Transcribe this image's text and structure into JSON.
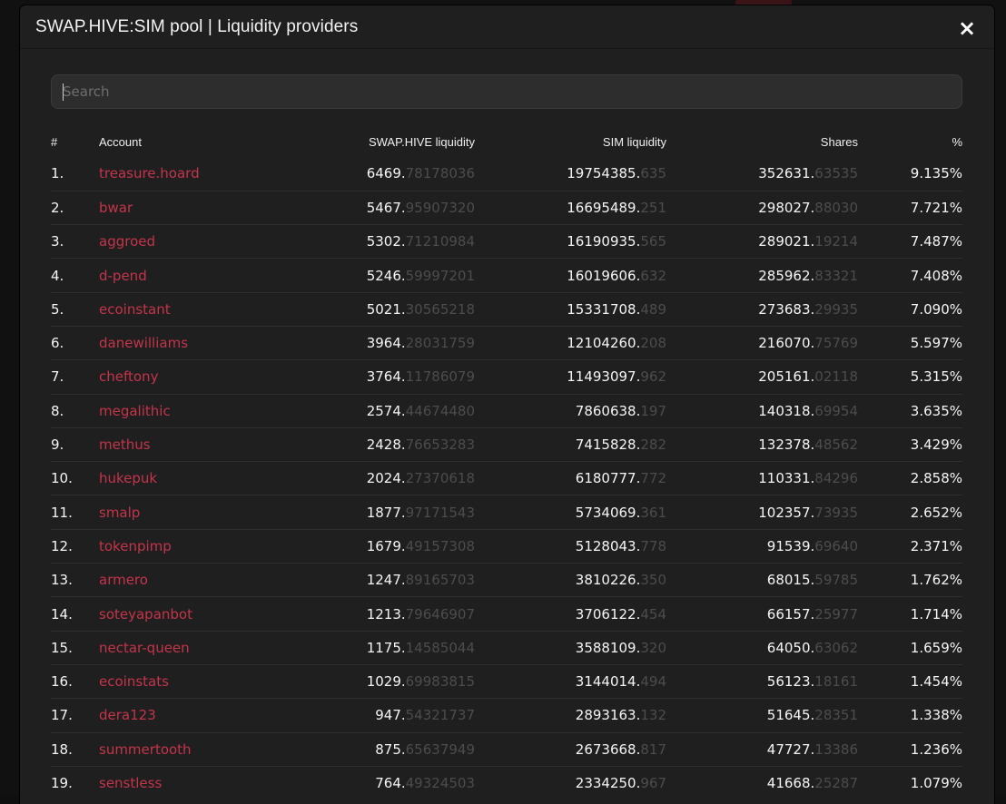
{
  "modal": {
    "title": "SWAP.HIVE:SIM pool | Liquidity providers",
    "close_label": "×"
  },
  "search": {
    "placeholder": "Search",
    "value": ""
  },
  "table": {
    "columns": [
      "#",
      "Account",
      "SWAP.HIVE liquidity",
      "SIM liquidity",
      "Shares",
      "%"
    ],
    "rows": [
      {
        "rank": "1.",
        "account": "treasure.hoard",
        "hive_int": "6469.",
        "hive_dec": "78178036",
        "sim_int": "19754385.",
        "sim_dec": "635",
        "shares_int": "352631.",
        "shares_dec": "63535",
        "pct": "9.135%"
      },
      {
        "rank": "2.",
        "account": "bwar",
        "hive_int": "5467.",
        "hive_dec": "95907320",
        "sim_int": "16695489.",
        "sim_dec": "251",
        "shares_int": "298027.",
        "shares_dec": "88030",
        "pct": "7.721%"
      },
      {
        "rank": "3.",
        "account": "aggroed",
        "hive_int": "5302.",
        "hive_dec": "71210984",
        "sim_int": "16190935.",
        "sim_dec": "565",
        "shares_int": "289021.",
        "shares_dec": "19214",
        "pct": "7.487%"
      },
      {
        "rank": "4.",
        "account": "d-pend",
        "hive_int": "5246.",
        "hive_dec": "59997201",
        "sim_int": "16019606.",
        "sim_dec": "632",
        "shares_int": "285962.",
        "shares_dec": "83321",
        "pct": "7.408%"
      },
      {
        "rank": "5.",
        "account": "ecoinstant",
        "hive_int": "5021.",
        "hive_dec": "30565218",
        "sim_int": "15331708.",
        "sim_dec": "489",
        "shares_int": "273683.",
        "shares_dec": "29935",
        "pct": "7.090%"
      },
      {
        "rank": "6.",
        "account": "danewilliams",
        "hive_int": "3964.",
        "hive_dec": "28031759",
        "sim_int": "12104260.",
        "sim_dec": "208",
        "shares_int": "216070.",
        "shares_dec": "75769",
        "pct": "5.597%"
      },
      {
        "rank": "7.",
        "account": "cheftony",
        "hive_int": "3764.",
        "hive_dec": "11786079",
        "sim_int": "11493097.",
        "sim_dec": "962",
        "shares_int": "205161.",
        "shares_dec": "02118",
        "pct": "5.315%"
      },
      {
        "rank": "8.",
        "account": "megalithic",
        "hive_int": "2574.",
        "hive_dec": "44674480",
        "sim_int": "7860638.",
        "sim_dec": "197",
        "shares_int": "140318.",
        "shares_dec": "69954",
        "pct": "3.635%"
      },
      {
        "rank": "9.",
        "account": "methus",
        "hive_int": "2428.",
        "hive_dec": "76653283",
        "sim_int": "7415828.",
        "sim_dec": "282",
        "shares_int": "132378.",
        "shares_dec": "48562",
        "pct": "3.429%"
      },
      {
        "rank": "10.",
        "account": "hukepuk",
        "hive_int": "2024.",
        "hive_dec": "27370618",
        "sim_int": "6180777.",
        "sim_dec": "772",
        "shares_int": "110331.",
        "shares_dec": "84296",
        "pct": "2.858%"
      },
      {
        "rank": "11.",
        "account": "smalp",
        "hive_int": "1877.",
        "hive_dec": "97171543",
        "sim_int": "5734069.",
        "sim_dec": "361",
        "shares_int": "102357.",
        "shares_dec": "73935",
        "pct": "2.652%"
      },
      {
        "rank": "12.",
        "account": "tokenpimp",
        "hive_int": "1679.",
        "hive_dec": "49157308",
        "sim_int": "5128043.",
        "sim_dec": "778",
        "shares_int": "91539.",
        "shares_dec": "69640",
        "pct": "2.371%"
      },
      {
        "rank": "13.",
        "account": "armero",
        "hive_int": "1247.",
        "hive_dec": "89165703",
        "sim_int": "3810226.",
        "sim_dec": "350",
        "shares_int": "68015.",
        "shares_dec": "59785",
        "pct": "1.762%"
      },
      {
        "rank": "14.",
        "account": "soteyapanbot",
        "hive_int": "1213.",
        "hive_dec": "79646907",
        "sim_int": "3706122.",
        "sim_dec": "454",
        "shares_int": "66157.",
        "shares_dec": "25977",
        "pct": "1.714%"
      },
      {
        "rank": "15.",
        "account": "nectar-queen",
        "hive_int": "1175.",
        "hive_dec": "14585044",
        "sim_int": "3588109.",
        "sim_dec": "320",
        "shares_int": "64050.",
        "shares_dec": "63062",
        "pct": "1.659%"
      },
      {
        "rank": "16.",
        "account": "ecoinstats",
        "hive_int": "1029.",
        "hive_dec": "69983815",
        "sim_int": "3144014.",
        "sim_dec": "494",
        "shares_int": "56123.",
        "shares_dec": "18161",
        "pct": "1.454%"
      },
      {
        "rank": "17.",
        "account": "dera123",
        "hive_int": "947.",
        "hive_dec": "54321737",
        "sim_int": "2893163.",
        "sim_dec": "132",
        "shares_int": "51645.",
        "shares_dec": "28351",
        "pct": "1.338%"
      },
      {
        "rank": "18.",
        "account": "summertooth",
        "hive_int": "875.",
        "hive_dec": "65637949",
        "sim_int": "2673668.",
        "sim_dec": "817",
        "shares_int": "47727.",
        "shares_dec": "13386",
        "pct": "1.236%"
      },
      {
        "rank": "19.",
        "account": "senstless",
        "hive_int": "764.",
        "hive_dec": "49324503",
        "sim_int": "2334250.",
        "sim_dec": "967",
        "shares_int": "41668.",
        "shares_dec": "25287",
        "pct": "1.079%"
      }
    ]
  },
  "colors": {
    "account_link": "#c4344a",
    "decimal_muted": "#4c4c4c",
    "modal_bg": "#1f1f1f",
    "search_bg": "#2d2d2d"
  }
}
